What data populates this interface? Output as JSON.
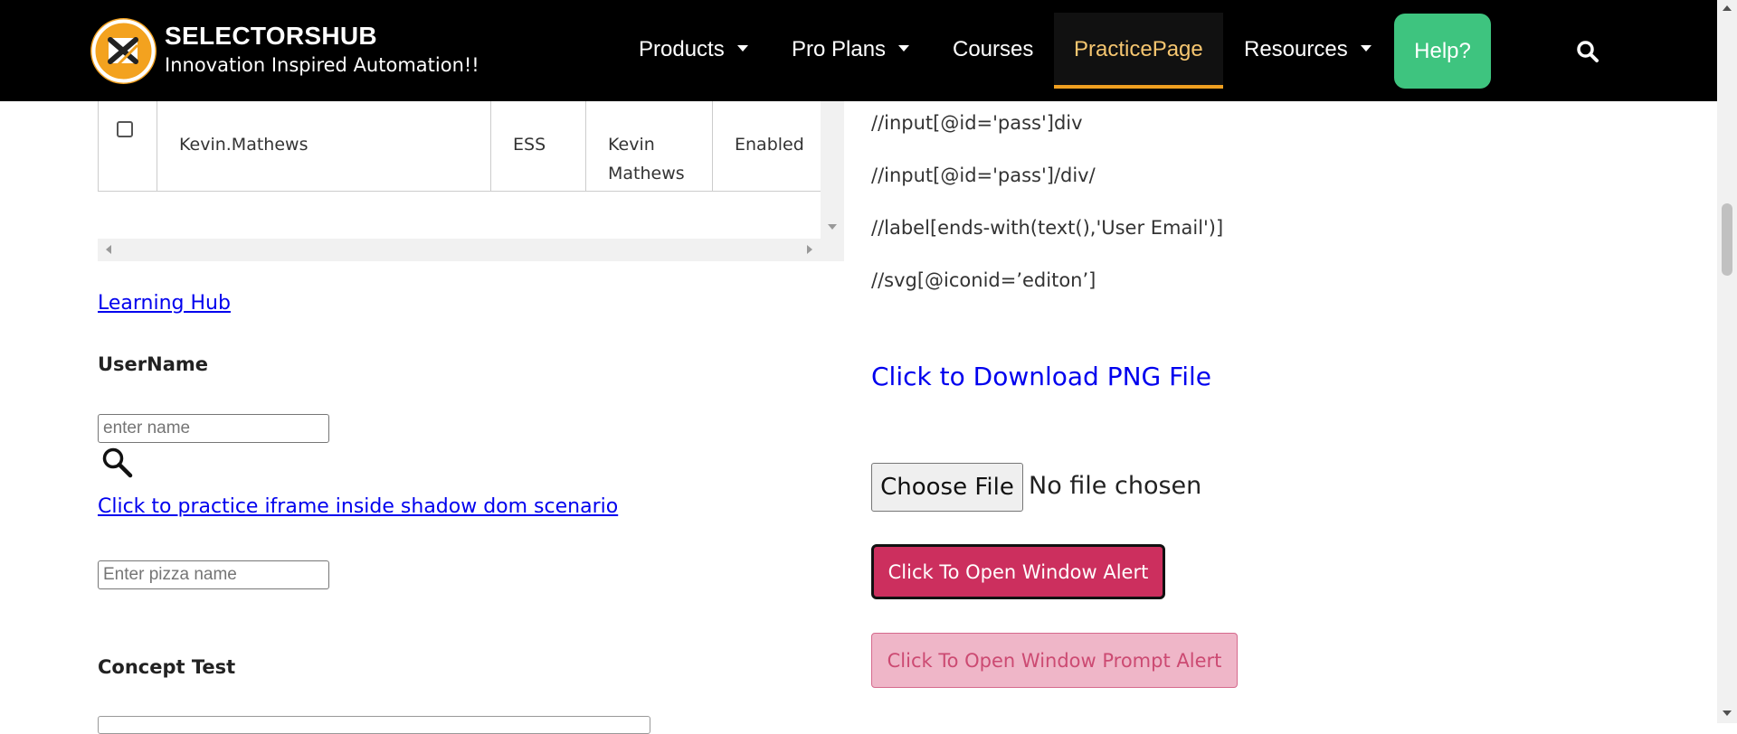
{
  "header": {
    "brand_title": "SELECTORSHUB",
    "brand_tagline": "Innovation Inspired Automation!!",
    "logo_icon": "selectorshub-logo-icon",
    "nav": [
      {
        "label": "Products",
        "has_caret": true
      },
      {
        "label": "Pro Plans",
        "has_caret": true
      },
      {
        "label": "Courses",
        "has_caret": false
      },
      {
        "label": "PracticePage",
        "has_caret": false,
        "active": true
      },
      {
        "label": "Resources",
        "has_caret": true
      }
    ],
    "help_label": "Help?",
    "search_icon": "search-icon",
    "colors": {
      "background": "#000000",
      "accent": "#f0a020",
      "help": "#3ec47f",
      "active_text": "#f6c670"
    }
  },
  "table": {
    "row": {
      "username": "Kevin.Mathews",
      "role": "ESS",
      "employee_name": "Kevin Mathews",
      "status": "Enabled"
    }
  },
  "left": {
    "learning_hub_link": "Learning Hub",
    "username_label": "UserName",
    "username_placeholder": "enter name",
    "iframe_link": "Click to practice iframe inside shadow dom scenario",
    "pizza_placeholder": "Enter pizza name",
    "concept_test_label": "Concept Test"
  },
  "right": {
    "xpaths": [
      "//input[@id='pass']div",
      "//input[@id='pass']/div/",
      "//label[ends-with(text(),'User Email')]",
      "//svg[@iconid=’editon’]"
    ],
    "download_link": "Click to Download PNG File",
    "choose_file_label": "Choose File",
    "no_file_text": "No file chosen",
    "window_alert_button": "Click To Open Window Alert",
    "prompt_alert_button": "Click To Open Window Prompt Alert",
    "colors": {
      "alert": "#cc2f5e",
      "prompt": "#efb6c8",
      "link": "#0000ee"
    }
  }
}
